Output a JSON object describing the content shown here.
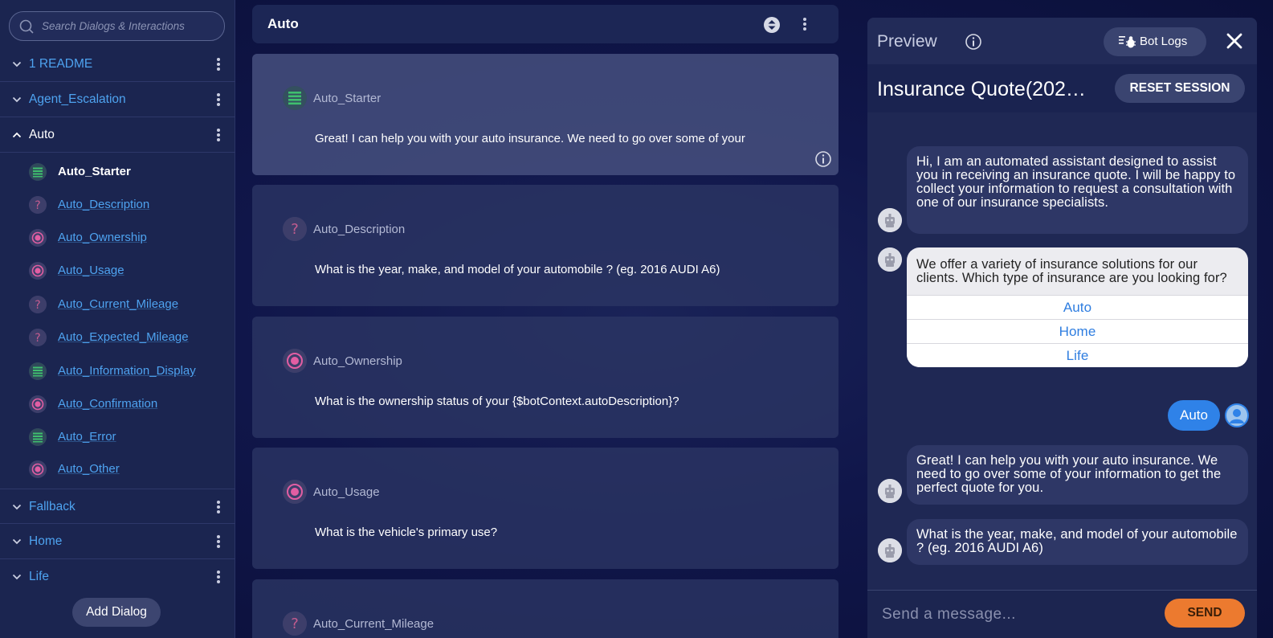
{
  "colors": {
    "accent_link": "#4ea3f0",
    "send_button": "#ec7a2f",
    "user_bubble": "#2f82e8",
    "icon_message": "#3fbf6e",
    "icon_question": "#a9487a",
    "icon_choice": "#e25ea3"
  },
  "sidebar": {
    "search_placeholder": "Search Dialogs & Interactions",
    "groups": [
      {
        "label": "1 README",
        "expanded": false
      },
      {
        "label": "Agent_Escalation",
        "expanded": false
      },
      {
        "label": "Auto",
        "expanded": true
      },
      {
        "label": "Fallback",
        "expanded": false
      },
      {
        "label": "Home",
        "expanded": false
      },
      {
        "label": "Life",
        "expanded": false
      }
    ],
    "auto_items": [
      {
        "label": "Auto_Starter",
        "icon": "message-icon"
      },
      {
        "label": "Auto_Description",
        "icon": "question-icon"
      },
      {
        "label": "Auto_Ownership",
        "icon": "choice-icon"
      },
      {
        "label": "Auto_Usage",
        "icon": "choice-icon"
      },
      {
        "label": "Auto_Current_Mileage",
        "icon": "question-icon"
      },
      {
        "label": "Auto_Expected_Mileage",
        "icon": "question-icon"
      },
      {
        "label": "Auto_Information_Display",
        "icon": "message-icon"
      },
      {
        "label": "Auto_Confirmation",
        "icon": "choice-icon"
      },
      {
        "label": "Auto_Error",
        "icon": "message-icon"
      },
      {
        "label": "Auto_Other",
        "icon": "choice-icon"
      }
    ],
    "add_dialog_label": "Add Dialog"
  },
  "main": {
    "title": "Auto",
    "cards": [
      {
        "name": "Auto_Starter",
        "icon": "message-icon",
        "text": "Great! I can help you with your auto insurance. We need to go over some of your"
      },
      {
        "name": "Auto_Description",
        "icon": "question-icon",
        "text": "What is the year, make, and model of your automobile ? (eg. 2016 AUDI A6)"
      },
      {
        "name": "Auto_Ownership",
        "icon": "choice-icon",
        "text": "What is the ownership status of your {$botContext.autoDescription}?"
      },
      {
        "name": "Auto_Usage",
        "icon": "choice-icon",
        "text": "What is the vehicle's primary use?"
      },
      {
        "name": "Auto_Current_Mileage",
        "icon": "question-icon",
        "text": ""
      }
    ]
  },
  "preview": {
    "title": "Preview",
    "bot_logs_label": "Bot Logs",
    "bot_name": "Insurance Quote(202…",
    "reset_label": "RESET SESSION",
    "messages": {
      "m1": "Hi, I am an automated assistant designed to assist you in receiving an insurance quote. I will be happy to collect your information to request a consultation with one of our insurance specialists.",
      "m2": "We offer a variety of insurance solutions for our clients. Which type of insurance are you looking for?",
      "options": [
        "Auto",
        "Home",
        "Life"
      ],
      "user_reply": "Auto",
      "m3": "Great! I can help you with your auto insurance. We need to go over some of your information to get the perfect quote for you.",
      "m4": "What is the year, make, and model of your automobile ? (eg. 2016 AUDI A6)"
    },
    "composer_placeholder": "Send a message...",
    "send_label": "SEND"
  }
}
